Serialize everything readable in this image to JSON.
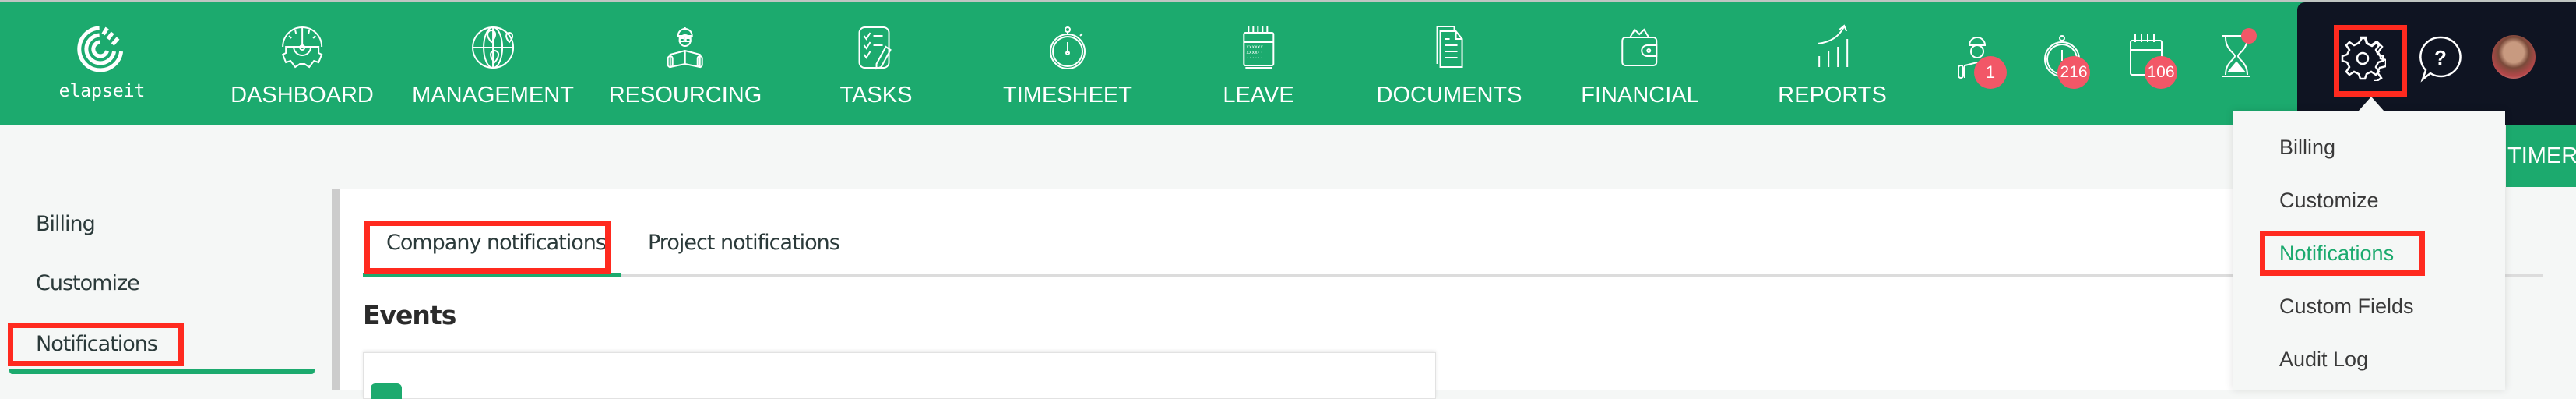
{
  "app": {
    "logo_text": "elapseit"
  },
  "nav": {
    "items": [
      {
        "label": "DASHBOARD",
        "icon": "dashboard-gauge-gear-icon"
      },
      {
        "label": "MANAGEMENT",
        "icon": "globe-pins-icon"
      },
      {
        "label": "RESOURCING",
        "icon": "engineer-blueprint-icon"
      },
      {
        "label": "TASKS",
        "icon": "checklist-pencil-icon"
      },
      {
        "label": "TIMESHEET",
        "icon": "stopwatch-icon"
      },
      {
        "label": "LEAVE",
        "icon": "calendar-icon"
      },
      {
        "label": "DOCUMENTS",
        "icon": "documents-icon"
      },
      {
        "label": "FINANCIAL",
        "icon": "wallet-icon"
      },
      {
        "label": "REPORTS",
        "icon": "growth-chart-icon"
      }
    ]
  },
  "quick": {
    "resourcing_badge": "1",
    "timesheet_badge": "216",
    "leave_badge": "106"
  },
  "colors": {
    "brand": "#1caa6e",
    "dark": "#0f1422",
    "badge": "#f25767",
    "highlight": "#ff2a1f"
  },
  "timer_label": "TIMER",
  "sidebar": {
    "items": [
      {
        "label": "Billing"
      },
      {
        "label": "Customize"
      },
      {
        "label": "Notifications"
      }
    ]
  },
  "tabs": [
    {
      "label": "Company notifications"
    },
    {
      "label": "Project notifications"
    }
  ],
  "section_title": "Events",
  "settings_menu": {
    "items": [
      {
        "label": "Billing"
      },
      {
        "label": "Customize"
      },
      {
        "label": "Notifications"
      },
      {
        "label": "Custom Fields"
      },
      {
        "label": "Audit Log"
      }
    ]
  }
}
